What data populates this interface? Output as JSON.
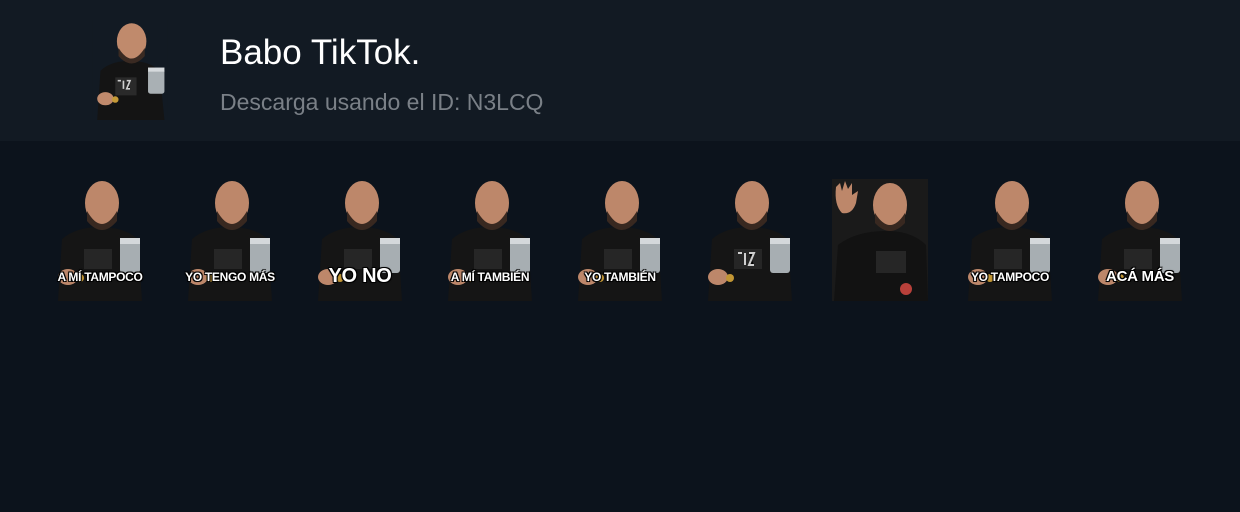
{
  "pack": {
    "title": "Babo TikTok.",
    "subtitle": "Descarga usando el ID: N3LCQ"
  },
  "stickers": [
    {
      "caption": "A MÍ TAMPOCO",
      "size": "small",
      "pose": "jar"
    },
    {
      "caption": "YO TENGO MÁS",
      "size": "small",
      "pose": "jar"
    },
    {
      "caption": "YO NO",
      "size": "big",
      "pose": "jar"
    },
    {
      "caption": "A MÍ TAMBIÉN",
      "size": "small",
      "pose": "jar"
    },
    {
      "caption": "YO TAMBIÉN",
      "size": "small",
      "pose": "jar"
    },
    {
      "caption": "",
      "size": "small",
      "pose": "jar"
    },
    {
      "caption": "",
      "size": "small",
      "pose": "wave"
    },
    {
      "caption": "YO TAMPOCO",
      "size": "small",
      "pose": "jar"
    },
    {
      "caption": "ACÁ MÁS",
      "size": "medium",
      "pose": "jar"
    }
  ],
  "colors": {
    "page_background": "#0c131c",
    "header_background": "#121a23",
    "title_text": "#ffffff",
    "subtitle_text": "#7a8087"
  }
}
